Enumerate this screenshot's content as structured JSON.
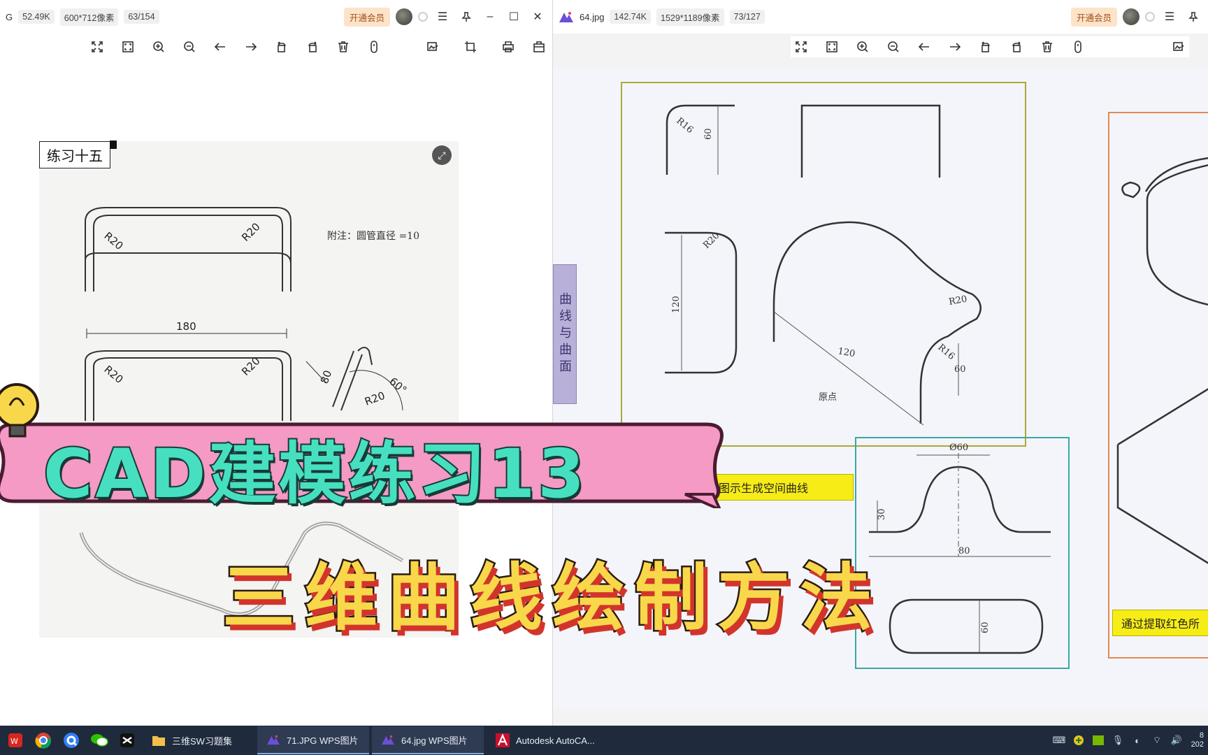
{
  "left_viewer": {
    "file_prefix": "G",
    "size": "52.49K",
    "dimensions": "600*712像素",
    "position": "63/154",
    "vip_button": "开通会员",
    "drawing": {
      "title": "练习十五",
      "note": "附注：圆管直径 =10",
      "labels": [
        "R20",
        "R20",
        "180",
        "R20",
        "R20",
        "80",
        "R20",
        "60°"
      ]
    }
  },
  "right_viewer": {
    "file_name": "64.jpg",
    "size": "142.74K",
    "dimensions": "1529*1189像素",
    "position": "73/127",
    "vip_button": "开通会员",
    "drawing": {
      "side_tab": "曲线与曲面",
      "yellow_label_1": "照图示生成空间曲线",
      "yellow_label_2": "通过提取红色所",
      "labels": [
        "R16",
        "60",
        "R20",
        "120",
        "R20",
        "120",
        "R16",
        "60",
        "原点",
        "Ø60",
        "30",
        "80",
        "60"
      ]
    }
  },
  "overlay": {
    "title": "CAD建模练习13",
    "subtitle": "三维曲线绘制方法"
  },
  "taskbar": {
    "apps": [
      {
        "label": "三维SW习题集"
      },
      {
        "label": "71.JPG   WPS图片"
      },
      {
        "label": "64.jpg   WPS图片"
      },
      {
        "label": "Autodesk AutoCA..."
      }
    ],
    "clock_time": "8",
    "clock_date": "202"
  },
  "colors": {
    "banner_pink": "#f49ac4",
    "banner_text": "#46e0c0",
    "subtitle_text": "#f8d84a",
    "taskbar_bg": "#1f2a3c",
    "yellow_label": "#f7ed16",
    "frame_green": "#a9a93a",
    "frame_teal": "#3aa7a4",
    "frame_orange": "#e38a52"
  },
  "icons": [
    "fit-screen-icon",
    "fullscreen-icon",
    "zoom-in-icon",
    "zoom-out-icon",
    "arrow-left-icon",
    "arrow-right-icon",
    "rotate-left-icon",
    "rotate-right-icon",
    "delete-icon",
    "info-icon",
    "edit-image-icon",
    "crop-icon",
    "print-icon",
    "share-icon"
  ]
}
